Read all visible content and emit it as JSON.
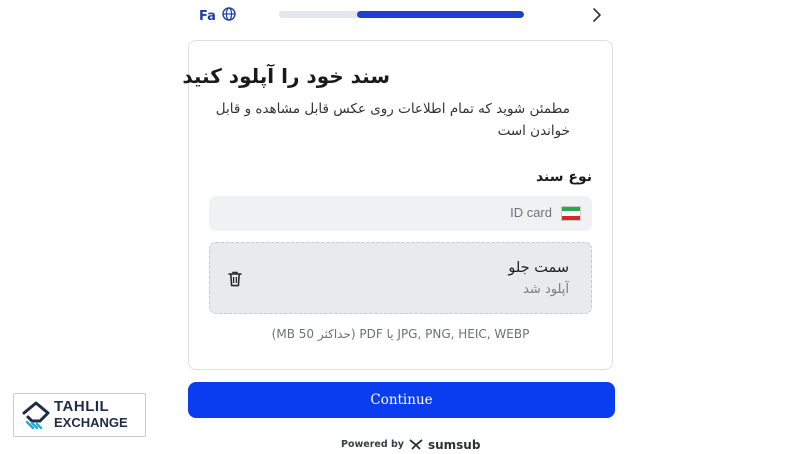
{
  "header": {
    "language_label": "Fa",
    "globe_icon": "globe-icon",
    "progress_fraction": 0.68,
    "back_icon": "chevron-right-icon",
    "accent_color": "#1f3fd0"
  },
  "card": {
    "title": "سند خود را آپلود کنید",
    "subtitle": "مطمئن شوید که تمام اطلاعات روی عکس قابل مشاهده و قابل خواندن است",
    "doc_type_label": "نوع سند",
    "doc_type_value": "ID card",
    "flag_icon": "iran-flag-icon",
    "upload": {
      "title": "سمت جلو",
      "status": "آپلود شد",
      "delete_icon": "trash-icon"
    },
    "formats_note": "JPG, PNG, HEIC, WEBP یا PDF (حداکثر 50 MB)"
  },
  "continue_label": "Continue",
  "continue_color": "#0b3df0",
  "footer": {
    "powered_label": "Powered by",
    "brand": "sumsub",
    "brand_icon": "sumsub-logo-icon"
  },
  "watermark": {
    "line1": "TAHLIL",
    "line2": "EXCHANGE",
    "logo_icon": "tahlil-logo-icon"
  }
}
